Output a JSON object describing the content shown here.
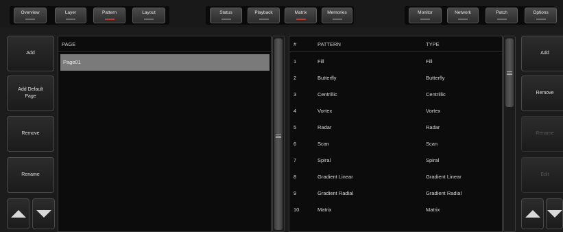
{
  "top_tabs": [
    {
      "label": "Overview"
    },
    {
      "label": "Layer"
    },
    {
      "label": "Pattern",
      "active": true
    },
    {
      "label": "Layout"
    },
    {
      "label": "Status"
    },
    {
      "label": "Playback"
    },
    {
      "label": "Matrix",
      "active": true
    },
    {
      "label": "Memories"
    },
    {
      "label": "Monitor"
    },
    {
      "label": "Network"
    },
    {
      "label": "Patch"
    },
    {
      "label": "Options"
    }
  ],
  "left_buttons": {
    "add": "Add",
    "add_default_line1": "Add Default",
    "add_default_line2": "Page",
    "remove": "Remove",
    "rename": "Rename"
  },
  "page_panel": {
    "header": "PAGE",
    "rows": [
      "Page01"
    ],
    "selected": "Page01"
  },
  "pattern_panel": {
    "headers": {
      "num": "#",
      "pattern": "PATTERN",
      "type": "TYPE"
    },
    "rows": [
      {
        "num": "1",
        "pattern": "Fill",
        "type": "Fill"
      },
      {
        "num": "2",
        "pattern": "Butterfly",
        "type": "Butterfly"
      },
      {
        "num": "3",
        "pattern": "Centrillic",
        "type": "Centrillic"
      },
      {
        "num": "4",
        "pattern": "Vortex",
        "type": "Vortex"
      },
      {
        "num": "5",
        "pattern": "Radar",
        "type": "Radar"
      },
      {
        "num": "6",
        "pattern": "Scan",
        "type": "Scan"
      },
      {
        "num": "7",
        "pattern": "Spiral",
        "type": "Spiral"
      },
      {
        "num": "8",
        "pattern": "Gradient Linear",
        "type": "Gradient Linear"
      },
      {
        "num": "9",
        "pattern": "Gradient Radial",
        "type": "Gradient Radial"
      },
      {
        "num": "10",
        "pattern": "Matrix",
        "type": "Matrix"
      }
    ]
  },
  "right_buttons": {
    "add": "Add",
    "remove": "Remove",
    "rename": "Rename",
    "edit": "Edit"
  },
  "colors": {
    "active_led": "#c0392b",
    "selected_row": "#7a7a7a",
    "panel_bg": "#0c0c0c"
  }
}
